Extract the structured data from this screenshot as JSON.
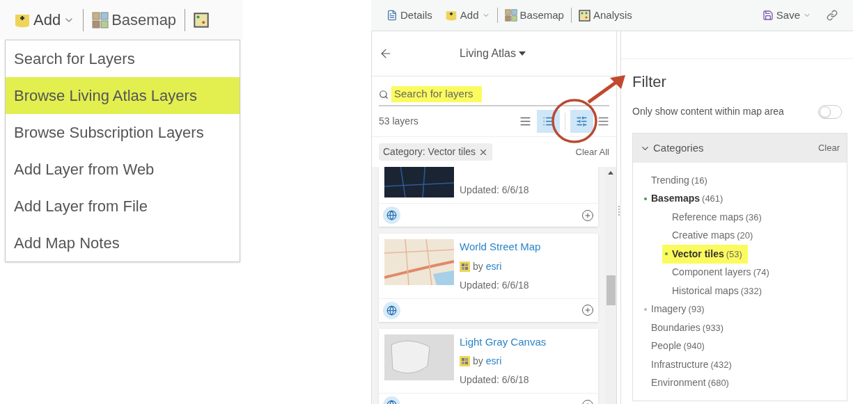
{
  "left_toolbar": {
    "add_label": "Add",
    "basemap_label": "Basemap"
  },
  "add_menu": {
    "items": [
      {
        "label": "Search for Layers",
        "highlighted": false
      },
      {
        "label": "Browse Living Atlas Layers",
        "highlighted": true
      },
      {
        "label": "Browse Subscription Layers",
        "highlighted": false
      },
      {
        "label": "Add Layer from Web",
        "highlighted": false
      },
      {
        "label": "Add Layer from File",
        "highlighted": false
      },
      {
        "label": "Add Map Notes",
        "highlighted": false
      }
    ]
  },
  "toolbar": {
    "details": "Details",
    "add": "Add",
    "basemap": "Basemap",
    "analysis": "Analysis",
    "save": "Save"
  },
  "layers_panel": {
    "title": "Living Atlas",
    "search": {
      "placeholder": "Search for layers",
      "highlighted": true
    },
    "count": "53 layers",
    "views": [
      {
        "kind": "list",
        "selected": false
      },
      {
        "kind": "detail",
        "selected": true
      }
    ],
    "filter_button": {
      "selected": true
    },
    "chip": "Category: Vector tiles",
    "clear_all": "Clear All",
    "cards": [
      {
        "kind": "dark",
        "updated": "Updated: 6/6/18"
      },
      {
        "kind": "street",
        "title": "World Street Map",
        "by": "by",
        "owner": "esri",
        "updated": "Updated: 6/6/18"
      },
      {
        "kind": "gray",
        "title": "Light Gray Canvas",
        "by": "by",
        "owner": "esri",
        "updated": "Updated: 6/6/18"
      }
    ]
  },
  "filter": {
    "title": "Filter",
    "map_area": {
      "label": "Only show content within map area",
      "on": false
    },
    "categories": {
      "title": "Categories",
      "clear": "Clear",
      "expanded": true,
      "items": [
        {
          "label": "Trending",
          "count": "(16)",
          "selected": false
        },
        {
          "label": "Basemaps",
          "count": "(461)",
          "selected": false,
          "expanded": true,
          "children": [
            {
              "label": "Reference maps",
              "count": "(36)",
              "selected": false
            },
            {
              "label": "Creative maps",
              "count": "(20)",
              "selected": false
            },
            {
              "label": "Vector tiles",
              "count": "(53)",
              "selected": true,
              "highlighted": true
            },
            {
              "label": "Component layers",
              "count": "(74)",
              "selected": false
            },
            {
              "label": "Historical maps",
              "count": "(332)",
              "selected": false
            }
          ]
        },
        {
          "label": "Imagery",
          "count": "(93)",
          "selected": false,
          "expanded": false
        },
        {
          "label": "Boundaries",
          "count": "(933)",
          "selected": false
        },
        {
          "label": "People",
          "count": "(940)",
          "selected": false
        },
        {
          "label": "Infrastructure",
          "count": "(432)",
          "selected": false
        },
        {
          "label": "Environment",
          "count": "(680)",
          "selected": false
        }
      ]
    }
  }
}
